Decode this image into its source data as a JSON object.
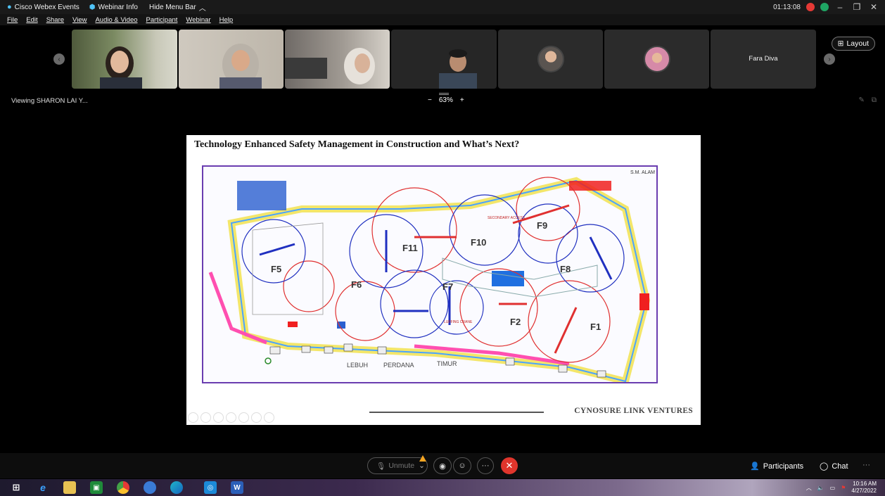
{
  "titlebar": {
    "app_name": "Cisco Webex Events",
    "webinar_info": "Webinar Info",
    "hide_menu": "Hide Menu Bar",
    "timer": "01:13:08"
  },
  "menu": [
    "File",
    "Edit",
    "Share",
    "View",
    "Audio & Video",
    "Participant",
    "Webinar",
    "Help"
  ],
  "participants_strip": {
    "tiles": [
      {
        "type": "video",
        "color": "#6b7a55"
      },
      {
        "type": "video",
        "color": "#c6c0b5"
      },
      {
        "type": "video",
        "color": "#8a8580"
      },
      {
        "type": "video",
        "color": "#2a2a2a"
      },
      {
        "type": "avatar",
        "color": "#9d8a76"
      },
      {
        "type": "avatar",
        "color": "#d8a8b8"
      },
      {
        "type": "name",
        "name": "Fara Diva"
      }
    ],
    "layout_label": "Layout"
  },
  "viewbar": {
    "viewing": "Viewing SHARON LAI Y...",
    "zoom_minus": "−",
    "zoom_value": "63%",
    "zoom_plus": "+"
  },
  "slide": {
    "title": "Technology Enhanced Safety Management in Construction and What’s Next?",
    "footer": "CYNOSURE LINK VENTURES",
    "plan_labels": {
      "f1": "F1",
      "f2": "F2",
      "f5": "F5",
      "f6": "F6",
      "f7": "F7",
      "f8": "F8",
      "f9": "F9",
      "f10": "F10",
      "f11": "F11",
      "road1": "LEBUH",
      "road2": "PERDANA",
      "road3": "TIMUR",
      "corner": "S.M. ALAM",
      "crane1": "LUFFING CRANE",
      "access1": "SECONDARY ACCESS"
    }
  },
  "controls": {
    "unmute": "Unmute",
    "participants": "Participants",
    "chat": "Chat",
    "more": "···"
  },
  "taskbar": {
    "time": "10:16 AM",
    "date": "4/27/2022",
    "word_label": "W"
  },
  "colors": {
    "end_call": "#e0352c",
    "record": "#e53935",
    "plan_border": "#6a3db0"
  }
}
